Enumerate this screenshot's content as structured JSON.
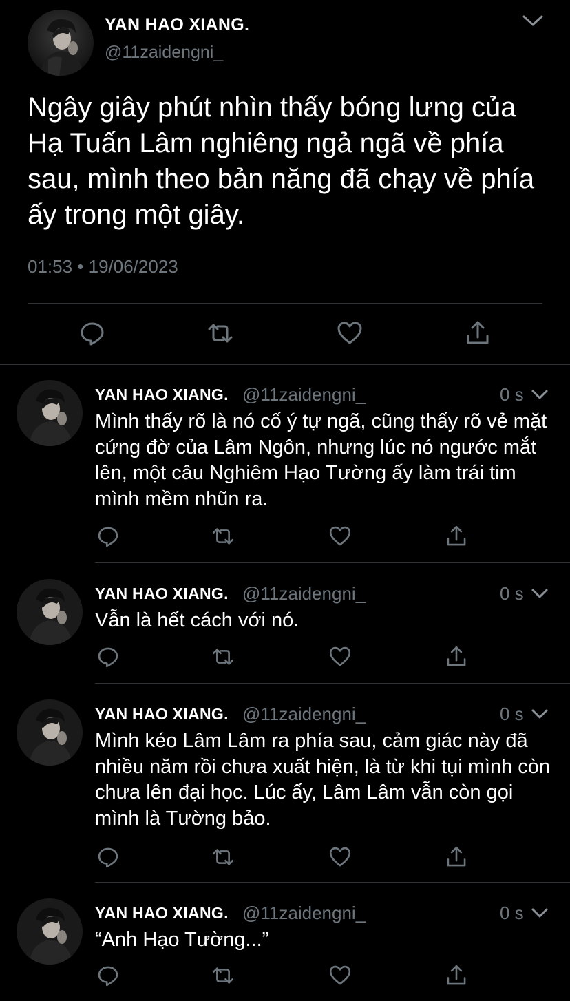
{
  "main_tweet": {
    "author_name": "YAN HAO XIANG.",
    "author_handle": "@11zaidengni_",
    "text": "Ngây giây phút nhìn thấy bóng lưng của Hạ Tuấn Lâm nghiêng ngả ngã về phía sau, mình theo bản năng đã chạy về phía ấy trong một giây.",
    "timestamp": "01:53 • 19/06/2023",
    "avatar_icon": "profile-photo",
    "menu_icon": "chevron-down-icon",
    "actions": [
      "reply-icon",
      "retweet-icon",
      "like-icon",
      "share-icon"
    ]
  },
  "replies": [
    {
      "author_name": "YAN HAO XIANG.",
      "author_handle": "@11zaidengni_",
      "time": "0 s",
      "text": "Mình thấy rõ là nó cố ý tự ngã, cũng thấy rõ vẻ mặt cứng đờ của Lâm Ngôn, nhưng lúc nó ngước mắt lên, một câu Nghiêm Hạo Tường ấy làm trái tim mình mềm nhũn ra."
    },
    {
      "author_name": "YAN HAO XIANG.",
      "author_handle": "@11zaidengni_",
      "time": "0 s",
      "text": "Vẫn là hết cách với nó."
    },
    {
      "author_name": "YAN HAO XIANG.",
      "author_handle": "@11zaidengni_",
      "time": "0 s",
      "text": "Mình kéo Lâm Lâm ra phía sau, cảm giác này đã nhiều năm rồi chưa xuất hiện, là từ khi tụi mình còn chưa lên đại học. Lúc ấy, Lâm Lâm vẫn còn gọi mình là Tường bảo."
    },
    {
      "author_name": "YAN HAO XIANG.",
      "author_handle": "@11zaidengni_",
      "time": "0 s",
      "text": "“Anh Hạo Tường...”"
    }
  ],
  "colors": {
    "background": "#000000",
    "text_primary": "#ffffff",
    "text_secondary": "#6e767d",
    "divider": "#2f3336",
    "icon": "#6e767d"
  }
}
